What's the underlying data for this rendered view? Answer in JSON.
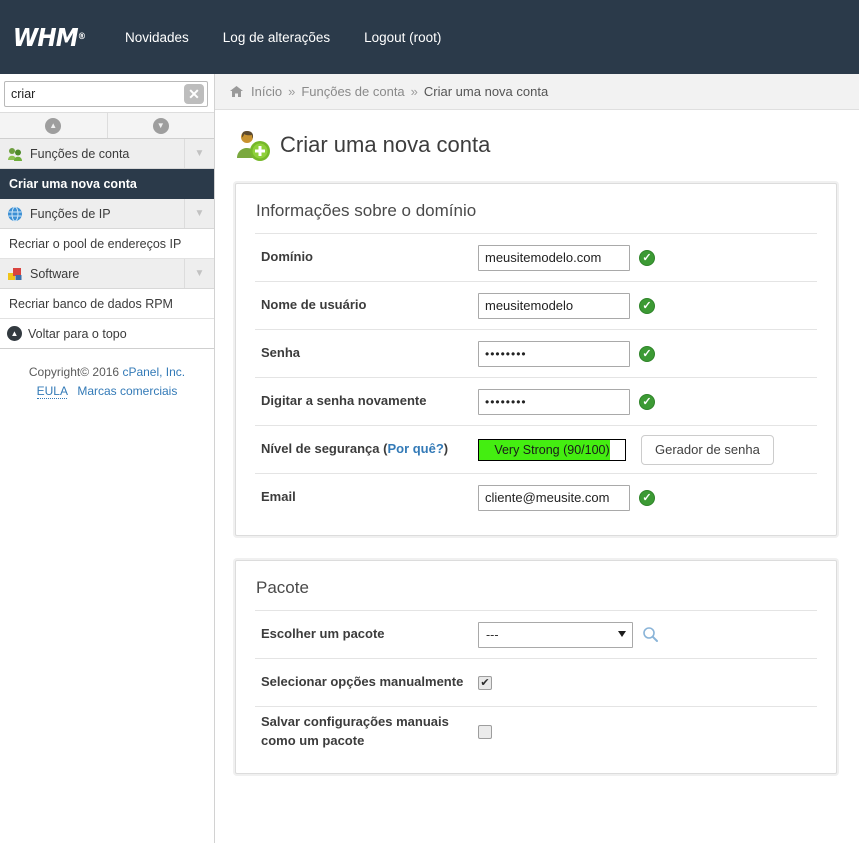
{
  "header": {
    "logo_text": "WHM",
    "logo_mark": "®",
    "nav": [
      {
        "label": "Novidades",
        "name": "nav-novidades"
      },
      {
        "label": "Log de alterações",
        "name": "nav-log-alteracoes"
      },
      {
        "label": "Logout (root)",
        "name": "nav-logout"
      }
    ]
  },
  "sidebar": {
    "search": {
      "value": "criar",
      "placeholder": "",
      "clear_icon": "close-icon"
    },
    "nav_arrows": {
      "up": "chevron-up-icon",
      "down": "chevron-down-icon"
    },
    "groups": [
      {
        "label": "Funções de conta",
        "icon": "users-icon",
        "chevron": "chevron-down-icon",
        "items": [
          {
            "label": "Criar uma nova conta",
            "active": true
          }
        ]
      },
      {
        "label": "Funções de IP",
        "icon": "globe-icon",
        "chevron": "chevron-down-icon",
        "items": [
          {
            "label": "Recriar o pool de endereços IP",
            "active": false
          }
        ]
      },
      {
        "label": "Software",
        "icon": "package-icon",
        "chevron": "chevron-down-icon",
        "items": [
          {
            "label": "Recriar banco de dados RPM",
            "active": false
          }
        ]
      }
    ],
    "back_to_top": {
      "label": "Voltar para o topo",
      "icon": "arrow-up-circle-icon"
    },
    "footer": {
      "copyright": "Copyright© 2016",
      "company": "cPanel, Inc.",
      "eula": "EULA",
      "trademarks": "Marcas comerciais"
    }
  },
  "breadcrumb": {
    "home_icon": "home-icon",
    "items": [
      "Início",
      "Funções de conta",
      "Criar uma nova conta"
    ],
    "separator": "»"
  },
  "page": {
    "title": "Criar uma nova conta",
    "icon": "add-user-icon"
  },
  "domain_panel": {
    "title": "Informações sobre o domínio",
    "fields": {
      "domain": {
        "label": "Domínio",
        "value": "meusitemodelo.com",
        "valid": true
      },
      "username": {
        "label": "Nome de usuário",
        "value": "meusitemodelo",
        "valid": true
      },
      "password": {
        "label": "Senha",
        "value": "••••••••",
        "valid": true
      },
      "password_repeat": {
        "label": "Digitar a senha novamente",
        "value": "••••••••",
        "valid": true
      },
      "strength": {
        "label": "Nível de segurança (",
        "label_link": "Por quê?",
        "label_end": ")",
        "text": "Very Strong (90/100)",
        "score": 90,
        "max": 100,
        "fill_color": "#44ee11",
        "button": "Gerador de senha"
      },
      "email": {
        "label": "Email",
        "value": "cliente@meusite.com",
        "valid": true
      }
    }
  },
  "package_panel": {
    "title": "Pacote",
    "fields": {
      "choose": {
        "label": "Escolher um pacote",
        "value": "---",
        "search_icon": "magnifier-icon"
      },
      "manual": {
        "label": "Selecionar opções manualmente",
        "checked": true
      },
      "save_as_package": {
        "label": "Salvar configurações manuais como um pacote",
        "checked": false
      }
    }
  }
}
